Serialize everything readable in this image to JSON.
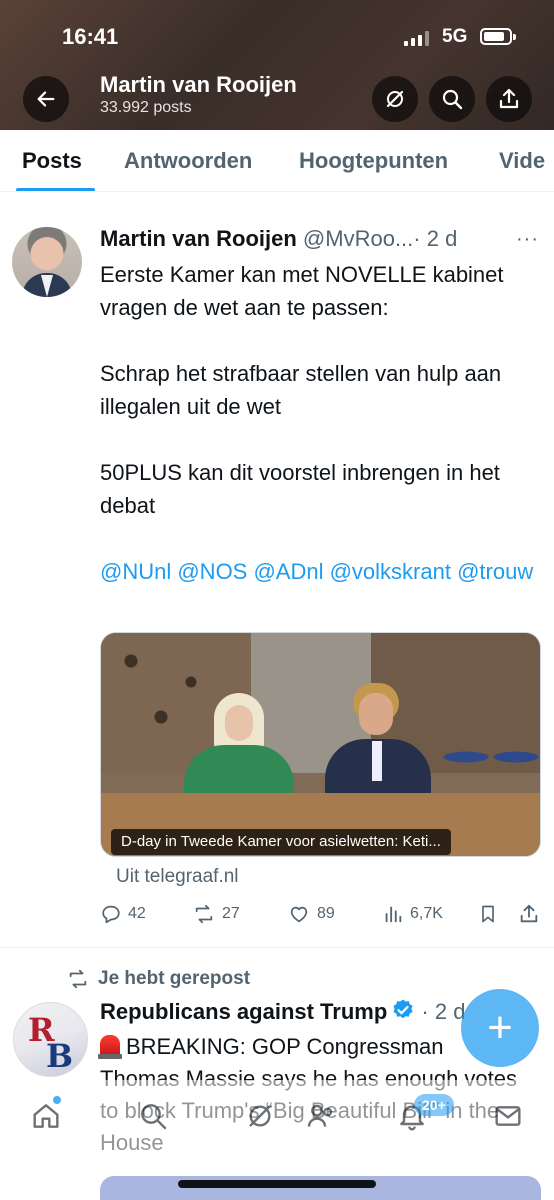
{
  "status_bar": {
    "time": "16:41",
    "network": "5G"
  },
  "profile_header": {
    "name": "Martin van Rooijen",
    "post_count": "33.992 posts"
  },
  "tabs": [
    {
      "label": "Posts",
      "active": true
    },
    {
      "label": "Antwoorden",
      "active": false
    },
    {
      "label": "Hoogtepunten",
      "active": false
    },
    {
      "label": "Vide",
      "active": false
    }
  ],
  "tweet1": {
    "author_name": "Martin van Rooijen",
    "handle": "@MvRoo...",
    "age": "· 2 d",
    "more": "···",
    "paragraphs": [
      "Eerste Kamer kan met NOVELLE kabinet vragen de wet aan te passen:",
      "Schrap het strafbaar stellen van hulp aan illegalen uit de wet",
      "50PLUS kan dit voorstel inbrengen in het debat"
    ],
    "mentions": "@NUnl @NOS @ADnl @volkskrant @trouw",
    "media_caption": "D-day in Tweede Kamer voor asielwetten: Keti...",
    "link_source": "Uit telegraaf.nl",
    "actions": {
      "replies": "42",
      "reposts": "27",
      "likes": "89",
      "views": "6,7K"
    }
  },
  "tweet2": {
    "repost_label": "Je hebt gerepost",
    "author_name": "Republicans against Trump",
    "age": "· 2 d",
    "body": "BREAKING: GOP Congressman Thomas Massie says he has enough votes to block Trump's “Big Beautiful Bill” in the House"
  },
  "bottom_nav": {
    "badge": "20+"
  },
  "colors": {
    "accent": "#1d9bf0",
    "text": "#0f1419",
    "secondary": "#536471"
  }
}
